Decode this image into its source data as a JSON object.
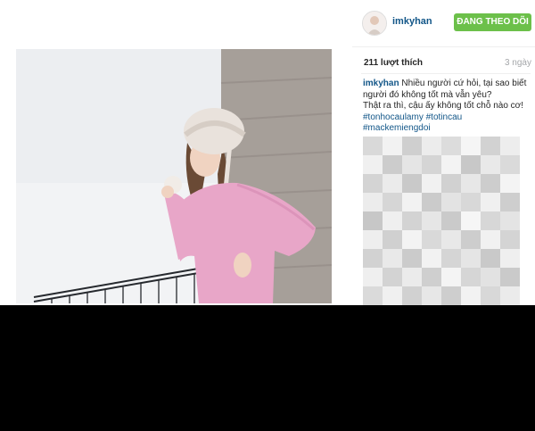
{
  "post": {
    "username": "imkyhan",
    "follow_label": "ĐANG THEO DÕI",
    "likes_text": "211 lượt thích",
    "time_ago": "3 ngày",
    "caption": {
      "username": "imkyhan",
      "line1": "Nhiều người cứ hỏi, tại sao biết người đó không tốt mà vẫn yêu?",
      "line2": "Thật ra thì, cậu ấy không tốt chỗ nào cơ!",
      "hashtags": [
        "#tonhocaulamy",
        "#totincau",
        "#mackemiengdoi"
      ]
    }
  },
  "colors": {
    "link": "#125688",
    "follow_button": "#6cc04a",
    "sweater": "#e8a6c8",
    "bottom_bar": "#000000"
  }
}
